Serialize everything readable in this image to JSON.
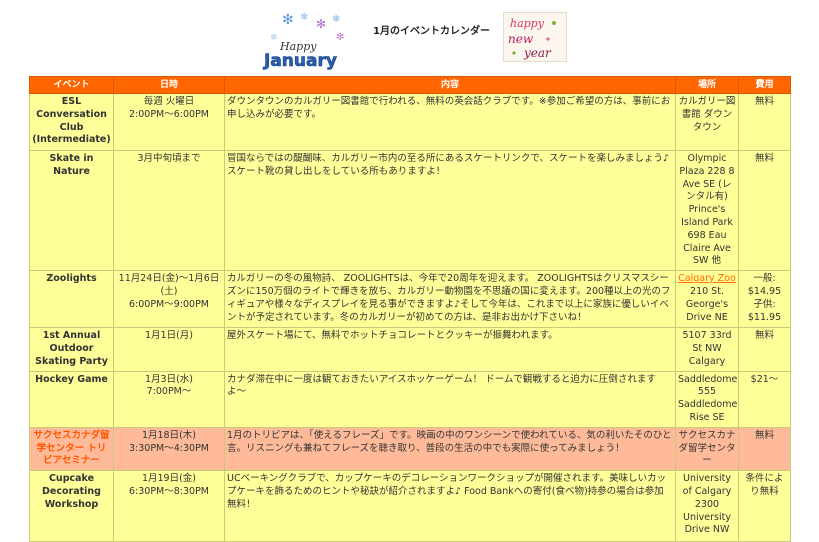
{
  "page": {
    "title": "1月のイベントカレンダー",
    "logo_left_text": "Happy January",
    "logo_right_text": "Happy New Year"
  },
  "colors": {
    "header_bg": "#ff6600",
    "row_bg": "#ffff99",
    "row_alt_bg": "#ffbb99",
    "link": "#ff6a00"
  },
  "table": {
    "headers": {
      "event": "イベント",
      "date": "日時",
      "desc": "内容",
      "place": "場所",
      "fee": "費用"
    },
    "rows": [
      {
        "event": "ESL Conversation Club (Intermediate)",
        "date": "毎週 火曜日\n2:00PM〜6:00PM",
        "desc": "ダウンタウンのカルガリー図書館で行われる、無料の英会話クラブです。※参加ご希望の方は、事前にお申し込みが必要です。",
        "place": "カルガリー図書館 ダウンタウン",
        "fee": "無料"
      },
      {
        "event": "Skate in Nature",
        "date": "3月中旬頃まで",
        "desc": "冒国ならではの醍醐味、カルガリー市内の至る所にあるスケートリンクで、スケートを楽しみましょう♪スケート靴の貸し出しをしている所もありますよ！",
        "place": "Olympic Plaza 228 8 Ave SE (レンタル有) Prince's Island Park 698 Eau Claire Ave SW 他",
        "fee": "無料"
      },
      {
        "event": "Zoolights",
        "date": "11月24日(金)〜1月6日(土)\n6:00PM〜9:00PM",
        "desc": "カルガリーの冬の風物詩、 ZOOLIGHTSは、今年で20周年を迎えます。 ZOOLIGHTSはクリスマスシーズンに150万個のライトで輝きを放ち、カルガリー動物園を不思議の国に変えます。200種以上の光のフィギュアや様々なディスプレイを見る事ができますよ♪そして今年は、これまで以上に家族に優しいイベントが予定されています。冬のカルガリーが初めての方は、是非お出かけ下さいね！",
        "place_link": "Calgary Zoo",
        "place": "210 St. George's Drive NE",
        "fee": "一般: $14.95\n子供: $11.95"
      },
      {
        "event": "1st Annual Outdoor Skating Party",
        "date": "1月1日(月)",
        "desc": "屋外スケート場にて、無料でホットチョコレートとクッキーが振舞われます。",
        "place": "5107 33rd St NW Calgary",
        "fee": "無料"
      },
      {
        "event": "Hockey Game",
        "date": "1月3日(水)\n7:00PM〜",
        "desc": "カナダ滞在中に一度は観ておきたいアイスホッケーゲーム！ ドームで観戦すると迫力に圧倒されますよ〜",
        "place": "Saddledome 555 Saddledome Rise SE",
        "fee": "$21〜"
      },
      {
        "event": "サクセスカナダ留学センター トリビアセミナー",
        "date": "1月18日(木)\n3:30PM〜4:30PM",
        "desc": "1月のトリビアは、「使えるフレーズ」です。映画の中のワンシーンで使われている、気の利いたそのひと言。リスニングも兼ねてフレーズを聴き取り、普段の生活の中でも実際に使ってみましょう！",
        "place": "サクセスカナダ留学センター",
        "fee": "無料"
      },
      {
        "event": "Cupcake Decorating Workshop",
        "date": "1月19日(金)\n6:30PM〜8:30PM",
        "desc": "UCベーキングクラブで、カップケーキのデコレーションワークショップが開催されます。美味しいカップケーキを飾るためのヒントや秘訣が紹介されますよ♪ Food Bankへの寄付(食べ物)持参の場合は参加無料！",
        "place": "University of Calgary 2300 University Drive NW",
        "fee": "条件により無料"
      }
    ]
  }
}
